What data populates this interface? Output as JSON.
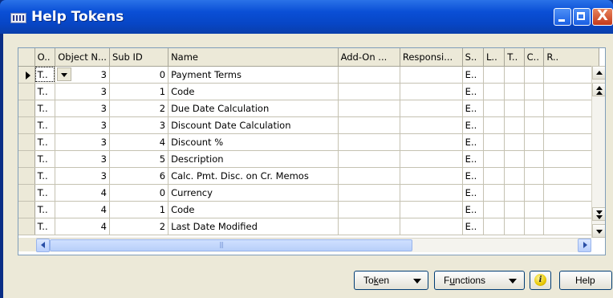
{
  "window": {
    "title": "Help Tokens"
  },
  "grid": {
    "columns": [
      "O..",
      "Object N...",
      "Sub ID",
      "Name",
      "Add-On ...",
      "Responsi...",
      "S..",
      "L..",
      "T..",
      "C..",
      "R.."
    ],
    "rows": [
      [
        "T..",
        "3",
        "0",
        "Payment Terms",
        "",
        "",
        "E..",
        "",
        "",
        "",
        ""
      ],
      [
        "T..",
        "3",
        "1",
        "Code",
        "",
        "",
        "E..",
        "",
        "",
        "",
        ""
      ],
      [
        "T..",
        "3",
        "2",
        "Due Date Calculation",
        "",
        "",
        "E..",
        "",
        "",
        "",
        ""
      ],
      [
        "T..",
        "3",
        "3",
        "Discount Date Calculation",
        "",
        "",
        "E..",
        "",
        "",
        "",
        ""
      ],
      [
        "T..",
        "3",
        "4",
        "Discount %",
        "",
        "",
        "E..",
        "",
        "",
        "",
        ""
      ],
      [
        "T..",
        "3",
        "5",
        "Description",
        "",
        "",
        "E..",
        "",
        "",
        "",
        ""
      ],
      [
        "T..",
        "3",
        "6",
        "Calc. Pmt. Disc. on Cr. Memos",
        "",
        "",
        "E..",
        "",
        "",
        "",
        ""
      ],
      [
        "T..",
        "4",
        "0",
        "Currency",
        "",
        "",
        "E..",
        "",
        "",
        "",
        ""
      ],
      [
        "T..",
        "4",
        "1",
        "Code",
        "",
        "",
        "E..",
        "",
        "",
        "",
        ""
      ],
      [
        "T..",
        "4",
        "2",
        "Last Date Modified",
        "",
        "",
        "E..",
        "",
        "",
        "",
        ""
      ]
    ],
    "selected_row": 0
  },
  "buttons": {
    "token": {
      "pre": "To",
      "accel": "k",
      "post": "en"
    },
    "functions": {
      "pre": "F",
      "accel": "u",
      "post": "nctions"
    },
    "info_glyph": "i",
    "help": "Help"
  },
  "titlebar_buttons": {
    "close_glyph": "X"
  },
  "colors": {
    "titlebar": "#0a4fd6",
    "client": "#ece9d8",
    "grid_border": "#7f9db9",
    "scroll_thumb": "#b8cff9"
  },
  "icons": [
    "window-icon",
    "minimize-icon",
    "maximize-icon",
    "close-icon",
    "row-pointer-icon",
    "dropdown-icon",
    "scroll-up-icon",
    "scroll-down-icon",
    "scroll-left-icon",
    "scroll-right-icon",
    "info-icon"
  ]
}
